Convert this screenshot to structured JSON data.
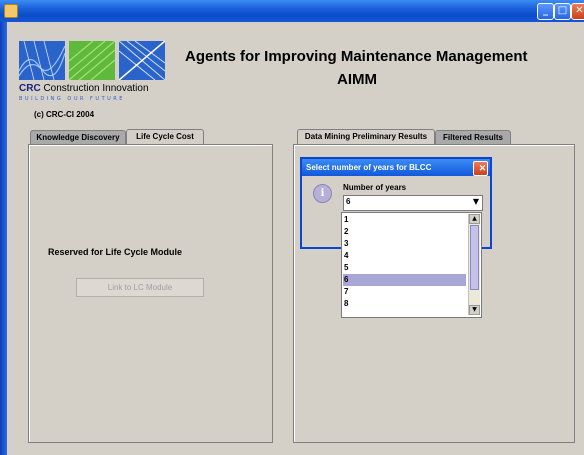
{
  "window": {
    "minimize_glyph": "_",
    "maximize_glyph": "□",
    "close_glyph": "✕"
  },
  "logo": {
    "brand_bold": "CRC",
    "brand_rest": " Construction Innovation",
    "tagline": "BUILDING OUR FUTURE"
  },
  "copyright": "(c) CRC-CI 2004",
  "header": {
    "title": "Agents for Improving Maintenance Management",
    "subtitle": "AIMM"
  },
  "left_tabs": [
    {
      "label": "Knowledge Discovery",
      "active": false
    },
    {
      "label": "Life Cycle Cost",
      "active": true
    }
  ],
  "left_panel": {
    "reserved_text": "Reserved for Life Cycle Module",
    "link_button": "Link to LC Module",
    "link_button_enabled": false
  },
  "right_tabs": [
    {
      "label": "Data Mining Preliminary Results",
      "active": true
    },
    {
      "label": "Filtered Results",
      "active": false
    }
  ],
  "dialog": {
    "title": "Select number of years for BLCC",
    "close_glyph": "✕",
    "info_glyph": "i",
    "label": "Number of years",
    "selected": "6",
    "arrow_glyph": "▼",
    "options": [
      "1",
      "2",
      "3",
      "4",
      "5",
      "6",
      "7",
      "8"
    ],
    "scroll_up_glyph": "▲",
    "scroll_down_glyph": "▼"
  },
  "colors": {
    "titlebar": "#1b5fd9",
    "selection": "#a8a6d6",
    "window_bg": "#d4d0c8"
  }
}
